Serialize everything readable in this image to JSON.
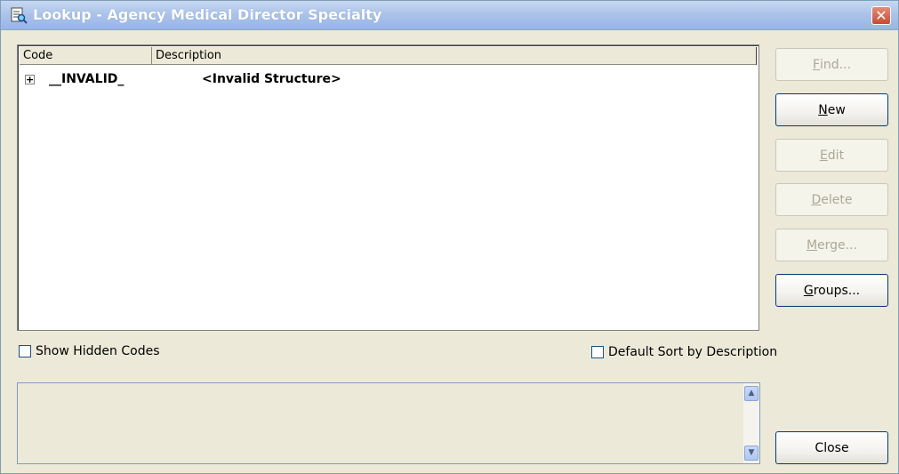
{
  "window": {
    "title": "Lookup - Agency Medical Director Specialty",
    "close_glyph": "✕"
  },
  "list": {
    "columns": [
      "Code",
      "Description"
    ],
    "rows": [
      {
        "expander": "+",
        "code": "__INVALID_",
        "description": "<Invalid Structure>"
      }
    ]
  },
  "options": {
    "show_hidden_codes": {
      "label": "Show Hidden Codes",
      "checked": false
    },
    "default_sort": {
      "label": "Default Sort by Description",
      "checked": false
    }
  },
  "memo": {
    "value": ""
  },
  "buttons": {
    "find": {
      "mnemonic": "F",
      "rest": "ind...",
      "enabled": false
    },
    "new": {
      "mnemonic": "N",
      "rest": "ew",
      "enabled": true
    },
    "edit": {
      "mnemonic": "E",
      "rest": "dit",
      "enabled": false
    },
    "delete": {
      "mnemonic": "D",
      "rest": "elete",
      "enabled": false
    },
    "merge": {
      "mnemonic": "M",
      "rest": "erge...",
      "enabled": false
    },
    "groups": {
      "mnemonic": "G",
      "rest": "roups...",
      "enabled": true
    },
    "close": {
      "label": "Close",
      "enabled": true
    }
  },
  "icons": {
    "title": "lookup-document-icon",
    "scroll_up": "▲",
    "scroll_down": "▼"
  }
}
